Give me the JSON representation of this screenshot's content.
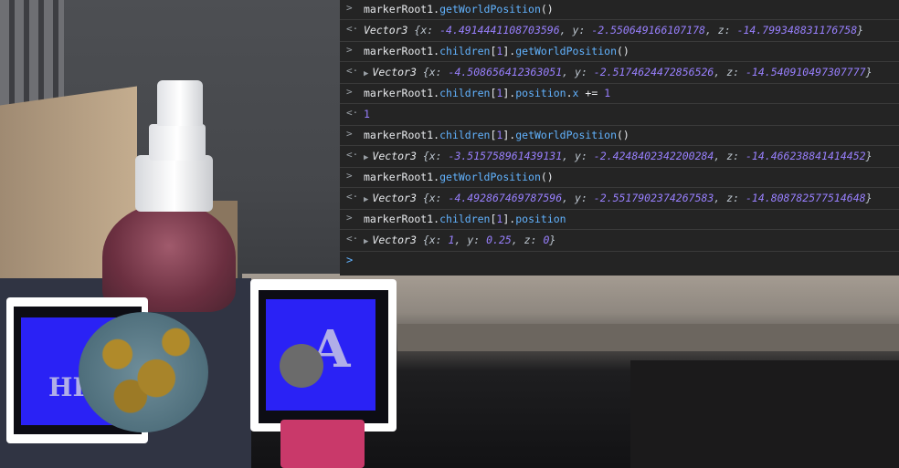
{
  "console": {
    "entries": [
      {
        "kind": "input",
        "gutter": ">",
        "parts": [
          {
            "t": "markerRoot1.",
            "c": "plain"
          },
          {
            "t": "getWorldPosition",
            "c": "m"
          },
          {
            "t": "()",
            "c": "plain"
          }
        ]
      },
      {
        "kind": "output",
        "gutter": "<·",
        "type": "Vector3",
        "x": "-4.4914441108703596",
        "y": "-2.550649166107178",
        "z": "-14.799348831176758",
        "expand": false
      },
      {
        "kind": "input",
        "gutter": ">",
        "parts": [
          {
            "t": "markerRoot1.",
            "c": "plain"
          },
          {
            "t": "children",
            "c": "m"
          },
          {
            "t": "[",
            "c": "plain"
          },
          {
            "t": "1",
            "c": "n"
          },
          {
            "t": "].",
            "c": "plain"
          },
          {
            "t": "getWorldPosition",
            "c": "m"
          },
          {
            "t": "()",
            "c": "plain"
          }
        ]
      },
      {
        "kind": "output",
        "gutter": "<·",
        "type": "Vector3",
        "x": "-4.508656412363051",
        "y": "-2.5174624472856526",
        "z": "-14.540910497307777",
        "expand": true
      },
      {
        "kind": "input",
        "gutter": ">",
        "parts": [
          {
            "t": "markerRoot1.",
            "c": "plain"
          },
          {
            "t": "children",
            "c": "m"
          },
          {
            "t": "[",
            "c": "plain"
          },
          {
            "t": "1",
            "c": "n"
          },
          {
            "t": "].",
            "c": "plain"
          },
          {
            "t": "position",
            "c": "m"
          },
          {
            "t": ".",
            "c": "plain"
          },
          {
            "t": "x",
            "c": "m"
          },
          {
            "t": " += ",
            "c": "plain"
          },
          {
            "t": "1",
            "c": "n"
          }
        ]
      },
      {
        "kind": "value",
        "gutter": "<·",
        "value": "1"
      },
      {
        "kind": "input",
        "gutter": ">",
        "parts": [
          {
            "t": "markerRoot1.",
            "c": "plain"
          },
          {
            "t": "children",
            "c": "m"
          },
          {
            "t": "[",
            "c": "plain"
          },
          {
            "t": "1",
            "c": "n"
          },
          {
            "t": "].",
            "c": "plain"
          },
          {
            "t": "getWorldPosition",
            "c": "m"
          },
          {
            "t": "()",
            "c": "plain"
          }
        ]
      },
      {
        "kind": "output",
        "gutter": "<·",
        "type": "Vector3",
        "x": "-3.515758961439131",
        "y": "-2.4248402342200284",
        "z": "-14.466238841414452",
        "expand": true
      },
      {
        "kind": "input",
        "gutter": ">",
        "parts": [
          {
            "t": "markerRoot1.",
            "c": "plain"
          },
          {
            "t": "getWorldPosition",
            "c": "m"
          },
          {
            "t": "()",
            "c": "plain"
          }
        ]
      },
      {
        "kind": "output",
        "gutter": "<·",
        "type": "Vector3",
        "x": "-4.492867469787596",
        "y": "-2.5517902374267583",
        "z": "-14.808782577514648",
        "expand": true
      },
      {
        "kind": "input",
        "gutter": ">",
        "parts": [
          {
            "t": "markerRoot1.",
            "c": "plain"
          },
          {
            "t": "children",
            "c": "m"
          },
          {
            "t": "[",
            "c": "plain"
          },
          {
            "t": "1",
            "c": "n"
          },
          {
            "t": "].",
            "c": "plain"
          },
          {
            "t": "position",
            "c": "m"
          }
        ]
      },
      {
        "kind": "output",
        "gutter": "<·",
        "type": "Vector3",
        "x": "1",
        "y": "0.25",
        "z": "0",
        "expand": true
      }
    ],
    "prompt_gutter": ">",
    "colors": {
      "background": "#242424",
      "method": "#62b3ff",
      "number": "#9980ff",
      "text": "#e8eaed"
    }
  },
  "scene": {
    "marker_left_letters": "HIR",
    "marker_right_letter": "A"
  }
}
